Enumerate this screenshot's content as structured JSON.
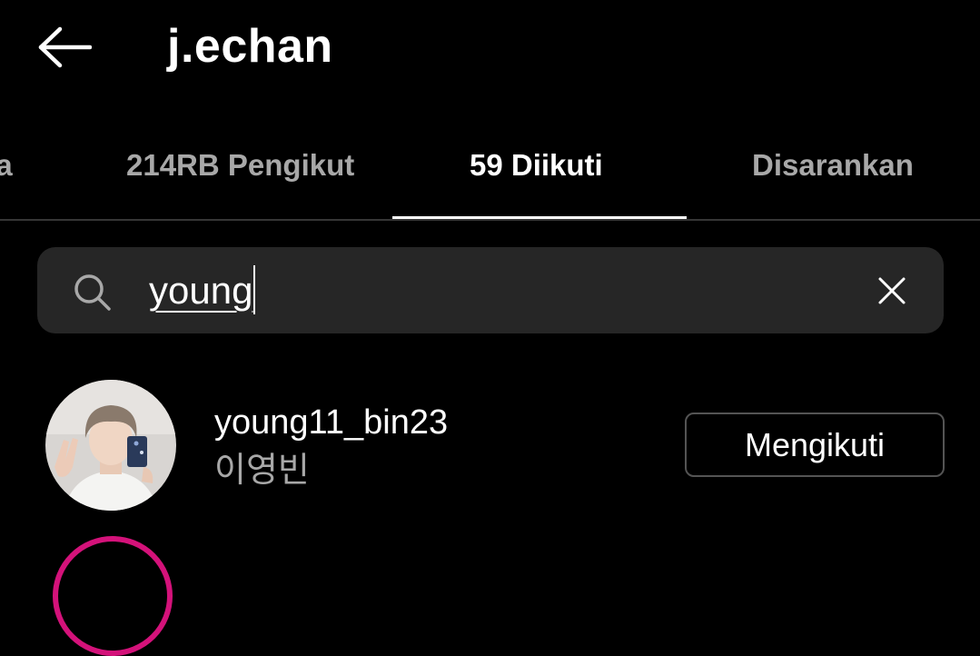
{
  "header": {
    "back_icon": "arrow-left-icon",
    "title": "j.echan"
  },
  "tabs": [
    {
      "label": "ma",
      "active": false
    },
    {
      "label": "214RB Pengikut",
      "active": false
    },
    {
      "label": "59 Diikuti",
      "active": true
    },
    {
      "label": "Disarankan",
      "active": false
    }
  ],
  "search": {
    "icon": "search-icon",
    "value": "young",
    "clear_icon": "close-icon"
  },
  "results": [
    {
      "username": "young11_bin23",
      "full_name": "이영빈",
      "button_label": "Mengikuti"
    }
  ],
  "colors": {
    "background": "#000000",
    "search_bg": "#262626",
    "secondary_text": "#a8a8a8",
    "story_ring": "#d4127a"
  }
}
